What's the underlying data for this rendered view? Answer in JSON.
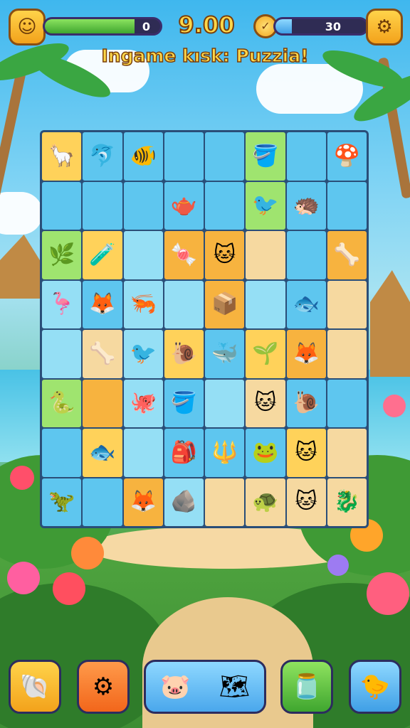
{
  "hud": {
    "avatar_icon": "face-icon",
    "health_value": "0",
    "health_fill": 0.78,
    "score": "9.00",
    "coin_icon": "coin-icon",
    "timer_value": "30",
    "timer_fill": 0.18,
    "settings_icon": "gear-icon"
  },
  "title": "Ingame kısk: Puzzia!",
  "board": {
    "rows": [
      [
        {
          "c": "yellow",
          "g": "🦙"
        },
        {
          "c": "blue",
          "g": "🐬"
        },
        {
          "c": "blue",
          "g": "🐠"
        },
        {
          "c": "blue",
          "g": ""
        },
        {
          "c": "blue",
          "g": ""
        },
        {
          "c": "green",
          "g": "🪣"
        },
        {
          "c": "blue",
          "g": ""
        },
        {
          "c": "blue",
          "g": "🍄"
        }
      ],
      [
        {
          "c": "blue",
          "g": ""
        },
        {
          "c": "blue",
          "g": ""
        },
        {
          "c": "blue",
          "g": ""
        },
        {
          "c": "blue",
          "g": "🫖"
        },
        {
          "c": "blue",
          "g": ""
        },
        {
          "c": "green",
          "g": "🐦"
        },
        {
          "c": "blue",
          "g": "🦔"
        },
        {
          "c": "blue",
          "g": ""
        }
      ],
      [
        {
          "c": "green",
          "g": "🌿"
        },
        {
          "c": "yellow",
          "g": "🧪"
        },
        {
          "c": "lblue",
          "g": ""
        },
        {
          "c": "orange",
          "g": "🍬"
        },
        {
          "c": "orange",
          "g": "🐱"
        },
        {
          "c": "sandc",
          "g": ""
        },
        {
          "c": "blue",
          "g": ""
        },
        {
          "c": "orange",
          "g": "🦴"
        }
      ],
      [
        {
          "c": "lblue",
          "g": "🦩"
        },
        {
          "c": "blue",
          "g": "🦊"
        },
        {
          "c": "lblue",
          "g": "🦐"
        },
        {
          "c": "lblue",
          "g": ""
        },
        {
          "c": "orange",
          "g": "📦"
        },
        {
          "c": "lblue",
          "g": ""
        },
        {
          "c": "blue",
          "g": "🐟"
        },
        {
          "c": "sandc",
          "g": ""
        }
      ],
      [
        {
          "c": "lblue",
          "g": ""
        },
        {
          "c": "sandc",
          "g": "🦴"
        },
        {
          "c": "lblue",
          "g": "🐦"
        },
        {
          "c": "yellow",
          "g": "🐌"
        },
        {
          "c": "blue",
          "g": "🐳"
        },
        {
          "c": "yellow",
          "g": "🌱"
        },
        {
          "c": "orange",
          "g": "🦊"
        },
        {
          "c": "sandc",
          "g": ""
        }
      ],
      [
        {
          "c": "green",
          "g": "🐍"
        },
        {
          "c": "orange",
          "g": ""
        },
        {
          "c": "lblue",
          "g": "🐙"
        },
        {
          "c": "blue",
          "g": "🪣"
        },
        {
          "c": "lblue",
          "g": ""
        },
        {
          "c": "sandc",
          "g": "🐱"
        },
        {
          "c": "blue",
          "g": "🐌"
        },
        {
          "c": "blue",
          "g": ""
        }
      ],
      [
        {
          "c": "blue",
          "g": ""
        },
        {
          "c": "yellow",
          "g": "🐟"
        },
        {
          "c": "lblue",
          "g": ""
        },
        {
          "c": "blue",
          "g": "🎒"
        },
        {
          "c": "blue",
          "g": "🔱"
        },
        {
          "c": "blue",
          "g": "🐸"
        },
        {
          "c": "yellow",
          "g": "🐱"
        },
        {
          "c": "sandc",
          "g": ""
        }
      ],
      [
        {
          "c": "blue",
          "g": "🦖"
        },
        {
          "c": "blue",
          "g": ""
        },
        {
          "c": "orange",
          "g": "🦊"
        },
        {
          "c": "lblue",
          "g": "🪨"
        },
        {
          "c": "sandc",
          "g": ""
        },
        {
          "c": "sandc",
          "g": "🐢"
        },
        {
          "c": "sandc",
          "g": "🐱"
        },
        {
          "c": "sandc",
          "g": "🐉"
        }
      ]
    ]
  },
  "bottom": {
    "slot1_icon": "shell-icon",
    "slot2_icon": "gear-heart-icon",
    "wide_icon_left": "pet-icon",
    "wide_icon_right": "map-icon",
    "slot4_icon": "jar-icon",
    "slot5_icon": "bird-icon"
  },
  "colors": {
    "hud_gold": "#ffd34a",
    "health": "#5ec53d",
    "timer": "#4fb6f2"
  }
}
